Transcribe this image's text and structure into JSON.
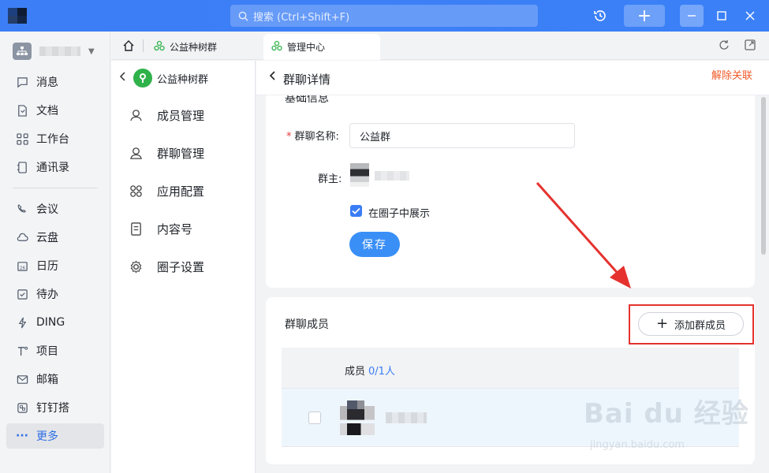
{
  "titlebar": {
    "search_placeholder": "搜索 (Ctrl+Shift+F)",
    "accent_color": "#3a7df6"
  },
  "leftnav": {
    "items": [
      {
        "label": "消息",
        "icon": "chat-bubble-icon"
      },
      {
        "label": "文档",
        "icon": "document-icon"
      },
      {
        "label": "工作台",
        "icon": "grid-apps-icon"
      },
      {
        "label": "通讯录",
        "icon": "contacts-book-icon"
      },
      {
        "label": "会议",
        "icon": "phone-video-icon"
      },
      {
        "label": "云盘",
        "icon": "cloud-icon"
      },
      {
        "label": "日历",
        "icon": "calendar-icon"
      },
      {
        "label": "待办",
        "icon": "todo-check-icon"
      },
      {
        "label": "DING",
        "icon": "lightning-icon"
      },
      {
        "label": "项目",
        "icon": "project-icon"
      },
      {
        "label": "邮箱",
        "icon": "mail-icon"
      },
      {
        "label": "钉钉搭",
        "icon": "builder-icon"
      },
      {
        "label": "更多",
        "icon": "more-dots-icon"
      }
    ]
  },
  "tabs": [
    {
      "label": "公益种树群",
      "icon": "group-tree-icon"
    },
    {
      "label": "管理中心",
      "icon": "group-tree-icon"
    }
  ],
  "subside": {
    "title": "公益种树群",
    "items": [
      {
        "label": "成员管理",
        "icon": "member-icon"
      },
      {
        "label": "群聊管理",
        "icon": "group-chat-icon"
      },
      {
        "label": "应用配置",
        "icon": "app-config-icon"
      },
      {
        "label": "内容号",
        "icon": "content-icon"
      },
      {
        "label": "圈子设置",
        "icon": "settings-gear-icon"
      }
    ]
  },
  "main": {
    "title": "群聊详情",
    "unlink_label": "解除关联",
    "basic_info_title": "基础信息",
    "name_label": "群聊名称:",
    "name_value": "公益群",
    "owner_label": "群主:",
    "show_in_circle_label": "在圈子中展示",
    "show_in_circle_checked": true,
    "save_label": "保存",
    "members_title": "群聊成员",
    "add_member_label": "添加群成员",
    "table_header_label": "成员",
    "table_header_count": "0/1人"
  },
  "watermark": {
    "main": "Bai du 经验",
    "sub": "jingyan.baidu.com"
  }
}
